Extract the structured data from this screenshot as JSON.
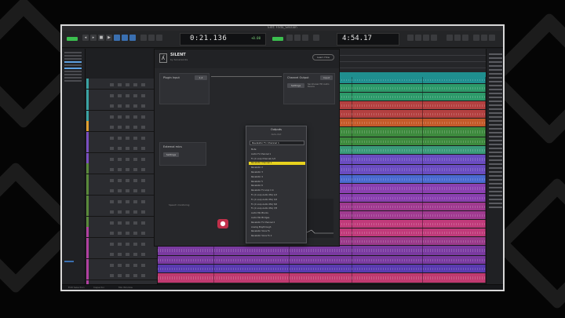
{
  "window": {
    "title": "Edit: Frida_Session"
  },
  "transport": {
    "counter_main": "0:21.136",
    "counter_sub": "+0.00",
    "counter_secondary": "4:54.17"
  },
  "plugin": {
    "name": "SILENT",
    "subtitle": "by Sonarworks",
    "learn_button": "Learn How",
    "plugin_input_label": "Plugin Input",
    "plugin_input_value": "1-2",
    "channel_output_label": "Channel Output",
    "channel_output_value": "Input",
    "settings_label": "Settings",
    "device_label": "Sennheiser HD Audio Device",
    "external_label": "External mics",
    "setting_chip": "Settings",
    "record_label": "Speech monitoring"
  },
  "dropdown": {
    "title": "Outputs",
    "subtitle": "Auto-Out",
    "field_value": "Revelator Fx Channel 1",
    "items": [
      "Mute",
      "Audio Fx Channel 1",
      "Fx (1 Loop Channel) 1/2",
      "Revelator Channel 1",
      "Revelator 2",
      "Revelator 3",
      "Revelator 4",
      "Revelator 5",
      "Revelator 6",
      "Revelator Fx Loop 1 In",
      "Fx (1 Loop Audio Mix) 1/2",
      "Fx (1 Loop Audio Mix) 3/4",
      "Fx (1 Loop Audio Mix) 5/6",
      "Fx (1 Loop Audio Mix) 7/8",
      "Audio Mix Blocks",
      "Audio Mix Bridges",
      "Revelator Fx Channel 2",
      "Analog Playthrough",
      "Revelator Voice Fx",
      "Revelator Voice Fx 2"
    ],
    "selected_index": 3
  },
  "status": {
    "left": "Edit Selection",
    "mid": "Inspector",
    "right": "Mix Window"
  },
  "colors": {
    "accent": "#e8d21e",
    "record": "#c0304a",
    "lane_teal": "#1f8f8f"
  }
}
